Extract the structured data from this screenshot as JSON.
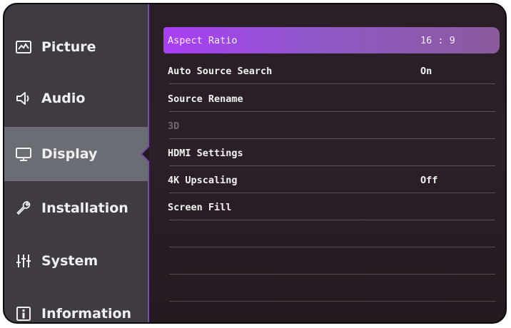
{
  "sidebar": {
    "items": [
      {
        "label": "Picture",
        "icon": "picture-icon"
      },
      {
        "label": "Audio",
        "icon": "speaker-icon"
      },
      {
        "label": "Display",
        "icon": "monitor-icon",
        "active": true
      },
      {
        "label": "Installation",
        "icon": "wrench-icon"
      },
      {
        "label": "System",
        "icon": "sliders-icon"
      },
      {
        "label": "Information",
        "icon": "info-icon"
      }
    ]
  },
  "display_menu": {
    "rows": [
      {
        "label": "Aspect Ratio",
        "value": "16 : 9",
        "selected": true
      },
      {
        "label": "Auto Source Search",
        "value": "On"
      },
      {
        "label": "Source Rename",
        "value": ""
      },
      {
        "label": "3D",
        "value": "",
        "disabled": true
      },
      {
        "label": "HDMI Settings",
        "value": ""
      },
      {
        "label": "4K Upscaling",
        "value": "Off"
      },
      {
        "label": "Screen Fill",
        "value": ""
      }
    ]
  },
  "colors": {
    "accent": "#a83ef5",
    "sidebar_bg": "#403b43",
    "active_item_bg": "#6a6d73",
    "content_bg": "#2a1f27"
  }
}
